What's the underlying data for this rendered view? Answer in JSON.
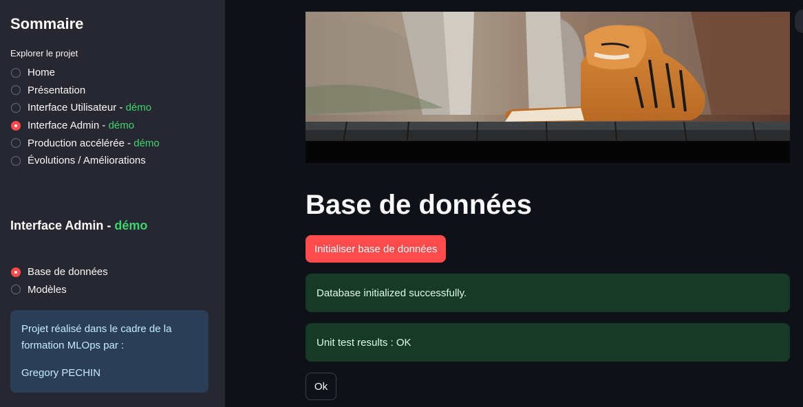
{
  "sidebar": {
    "title": "Sommaire",
    "nav_caption": "Explorer le projet",
    "nav_items": [
      {
        "label": "Home",
        "suffix": "",
        "selected": false
      },
      {
        "label": "Présentation",
        "suffix": "",
        "selected": false
      },
      {
        "label": "Interface Utilisateur - ",
        "suffix": "démo",
        "selected": false
      },
      {
        "label": "Interface Admin - ",
        "suffix": "démo",
        "selected": true
      },
      {
        "label": "Production accélérée - ",
        "suffix": "démo",
        "selected": false
      },
      {
        "label": "Évolutions / Améliorations",
        "suffix": "",
        "selected": false
      }
    ],
    "section_title": "Interface Admin - ",
    "section_title_suffix": "démo",
    "sub_items": [
      {
        "label": "Base de données",
        "selected": true
      },
      {
        "label": "Modèles",
        "selected": false
      }
    ],
    "info": {
      "text": "Projet réalisé dans le cadre de la formation MLOps par :",
      "author": "Gregory PECHIN"
    }
  },
  "main": {
    "title": "Base de données",
    "init_button": "Initialiser base de données",
    "alerts": [
      "Database initialized successfully.",
      "Unit test results : OK"
    ],
    "ok_button": "Ok"
  },
  "colors": {
    "accent": "#ff4b4b",
    "demo": "#3dd56d",
    "success_bg": "#173928",
    "sidebar_bg": "#262730",
    "main_bg": "#0e1117"
  }
}
